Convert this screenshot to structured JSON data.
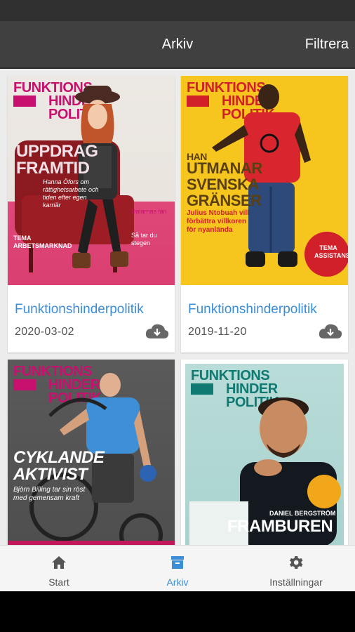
{
  "app_bar": {
    "title": "Arkiv",
    "filter_label": "Filtrera"
  },
  "colors": {
    "accent": "#3b8ed6",
    "appbar": "#404040",
    "nav_active": "#3b8ed6",
    "nav_inactive": "#555555"
  },
  "issues": [
    {
      "title": "Funktionshinderpolitik",
      "date": "2020-03-02",
      "cover": {
        "masthead_1": "FUNKTIONS",
        "masthead_2": "HINDER",
        "masthead_3": "POLITIK",
        "headline_1": "UPPDRAG",
        "headline_2": "FRAMTID",
        "teaser": "Hanna Öfors om rättighetsarbete och tiden efter egen karriär",
        "side_1": "Dalarnas län",
        "side_2": "Så tar du stegen",
        "side_3": "TEMA ARBETSMARKNAD"
      }
    },
    {
      "title": "Funktionshinderpolitik",
      "date": "2019-11-20",
      "cover": {
        "masthead_1": "FUNKTIONS",
        "masthead_2": "HINDER",
        "masthead_3": "POLITIK",
        "headline_1": "HAN",
        "headline_2": "UTMANAR",
        "headline_3": "SVENSKA",
        "headline_4": "GRÄNSER",
        "teaser": "Julius Ntobuah vill förbättra villkoren för nyanlända",
        "badge": "TEMA ASSISTANS"
      }
    },
    {
      "title": "",
      "date": "",
      "cover": {
        "masthead_1": "FUNKTIONS",
        "masthead_2": "HINDER",
        "masthead_3": "POLITIK",
        "headline_1": "CYKLANDE",
        "headline_2": "AKTIVIST",
        "teaser": "Björn Billing tar sin röst med gemensam kraft"
      }
    },
    {
      "title": "",
      "date": "",
      "cover": {
        "masthead_1": "FUNKTIONS",
        "masthead_2": "HINDER",
        "masthead_3": "POLITIK",
        "headline_1": "FRAMBUREN",
        "name": "DANIEL BERGSTRÖM"
      }
    }
  ],
  "bottom_nav": {
    "items": [
      {
        "label": "Start",
        "icon": "home-icon"
      },
      {
        "label": "Arkiv",
        "icon": "archive-icon",
        "active": true
      },
      {
        "label": "Inställningar",
        "icon": "gear-icon"
      }
    ]
  }
}
